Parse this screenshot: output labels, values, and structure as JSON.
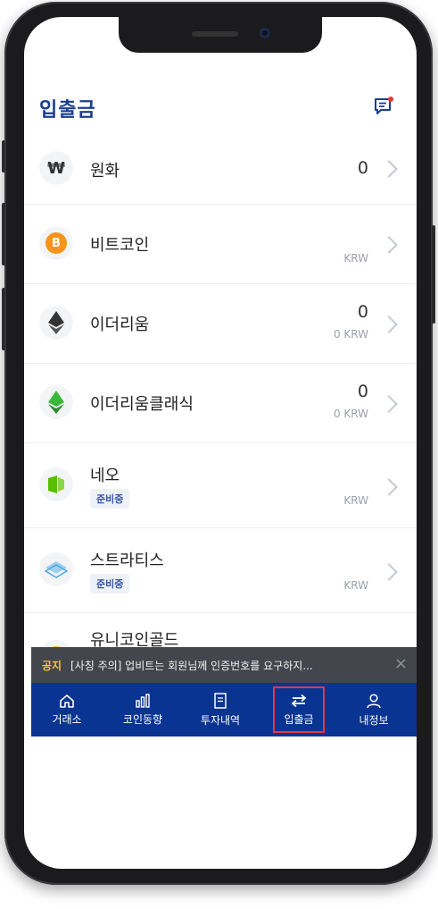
{
  "header": {
    "title": "입출금"
  },
  "coins": [
    {
      "symbol": "₩",
      "name": "원화",
      "amount": "0",
      "krw": "",
      "badge": ""
    },
    {
      "symbol": "B",
      "name": "비트코인",
      "amount": "",
      "krw": "KRW",
      "badge": ""
    },
    {
      "symbol": "",
      "name": "이더리움",
      "amount": "0",
      "krw": "0 KRW",
      "badge": ""
    },
    {
      "symbol": "",
      "name": "이더리움클래식",
      "amount": "0",
      "krw": "0 KRW",
      "badge": ""
    },
    {
      "symbol": "",
      "name": "네오",
      "amount": "",
      "krw": "KRW",
      "badge": "준비중"
    },
    {
      "symbol": "",
      "name": "스트라티스",
      "amount": "",
      "krw": "KRW",
      "badge": "준비중"
    },
    {
      "symbol": "",
      "name": "유니코인골드",
      "amount": "",
      "krw": "",
      "badge": ""
    }
  ],
  "notice": {
    "tag": "공지",
    "text": "[사칭 주의] 업비트는 회원님께 인증번호를 요구하지...",
    "close": "×"
  },
  "tabs": [
    {
      "label": "거래소",
      "icon": "home-icon"
    },
    {
      "label": "코인동향",
      "icon": "bar-chart-icon"
    },
    {
      "label": "투자내역",
      "icon": "document-icon"
    },
    {
      "label": "입출금",
      "icon": "transfer-arrows-icon",
      "active": true
    },
    {
      "label": "내정보",
      "icon": "user-icon"
    }
  ],
  "colors": {
    "brand": "#0a3491",
    "title": "#1b3e8f",
    "active_outline": "#e33a3a",
    "notice_bg": "#43474d"
  }
}
